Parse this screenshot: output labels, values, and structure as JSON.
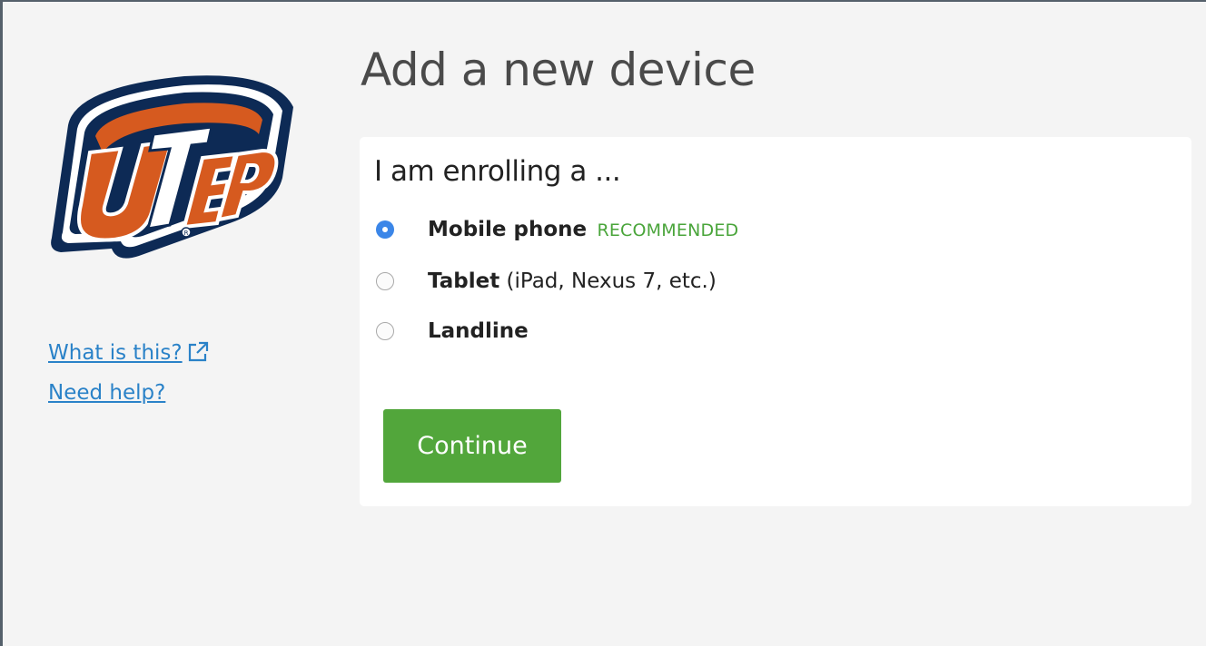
{
  "brand": {
    "logo_text": "UTEP",
    "colors": {
      "navy": "#0d2a55",
      "orange": "#d65a1f",
      "link": "#2a82c8",
      "accent_green": "#52a63b",
      "radio_blue": "#3b86e8"
    }
  },
  "sidebar": {
    "links": [
      {
        "label": "What is this?",
        "icon": "external-link-icon"
      },
      {
        "label": "Need help?"
      }
    ]
  },
  "main": {
    "title": "Add a new device",
    "card": {
      "heading": "I am enrolling a ...",
      "options": [
        {
          "name": "Mobile phone",
          "tag": "RECOMMENDED",
          "selected": true
        },
        {
          "name": "Tablet",
          "detail": " (iPad, Nexus 7, etc.)",
          "selected": false
        },
        {
          "name": "Landline",
          "selected": false
        }
      ],
      "continue_label": "Continue"
    }
  }
}
